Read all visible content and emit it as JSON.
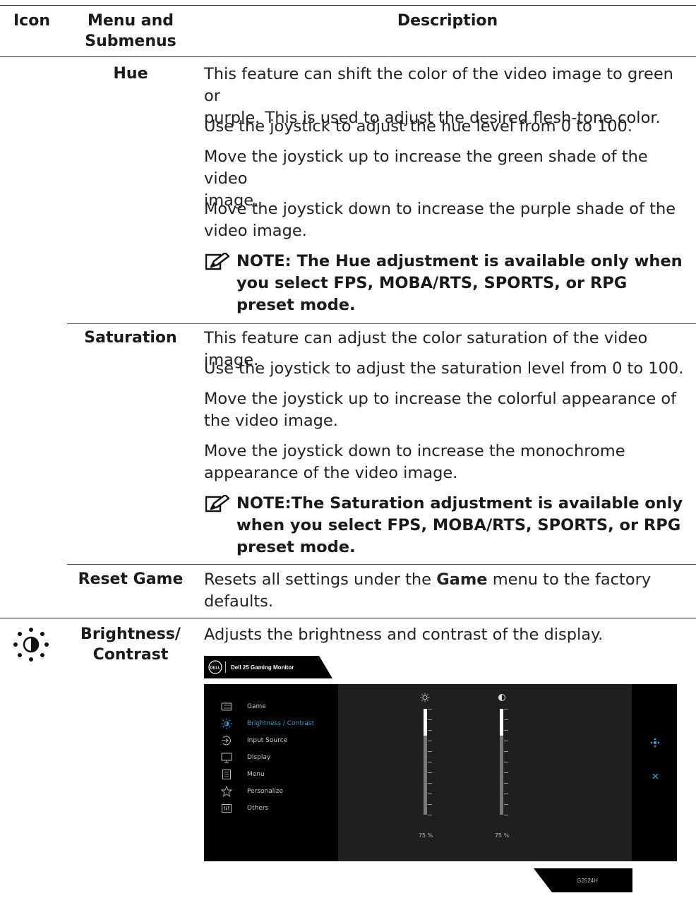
{
  "table_header": {
    "icon": "Icon",
    "menu_line1": "Menu and",
    "menu_line2": "Submenus",
    "description": "Description"
  },
  "rows": {
    "hue": {
      "name": "Hue",
      "p1a": "This feature can shift the color of the video image to green or",
      "p1b": "purple. This is used to adjust the desired flesh-tone color.",
      "p2": "Use the joystick to adjust the hue level from 0 to 100.",
      "p3a": "Move the joystick up to increase the green shade of the video",
      "p3b": "image.",
      "p4a": "Move the joystick down to increase the purple shade of the",
      "p4b": "video image.",
      "note_a": "NOTE: The Hue adjustment is available only when",
      "note_b": "you select FPS, MOBA/RTS, SPORTS, or RPG",
      "note_c": "preset mode."
    },
    "saturation": {
      "name": "Saturation",
      "p1": "This feature can adjust the color saturation of the video image.",
      "p2": "Use the joystick to adjust the saturation level from 0 to 100.",
      "p3a": "Move the joystick up to increase the colorful appearance of",
      "p3b": "the video image.",
      "p4a": "Move the joystick down to increase the monochrome",
      "p4b": "appearance of the video image.",
      "note_a": "NOTE:The Saturation adjustment is available only",
      "note_b": "when you select FPS, MOBA/RTS, SPORTS, or RPG",
      "note_c": "preset mode."
    },
    "reset_game": {
      "name": "Reset Game",
      "desc_pre": "Resets all settings under the ",
      "desc_bold": "Game",
      "desc_post": " menu to the factory",
      "desc_line2": "defaults."
    },
    "brightness": {
      "icon": "brightness-contrast-icon",
      "name_line1": "Brightness/",
      "name_line2": "Contrast",
      "desc": "Adjusts the brightness and contrast of the display."
    }
  },
  "osd": {
    "logo": "DELL",
    "title": "Dell 25 Gaming Monitor",
    "accent": "#2a9fd8",
    "menu": [
      {
        "label": "Game",
        "icon": "game-icon"
      },
      {
        "label": "Brightness / Contrast",
        "icon": "brightness-icon",
        "active": true
      },
      {
        "label": "Input Source",
        "icon": "input-source-icon"
      },
      {
        "label": "Display",
        "icon": "display-icon"
      },
      {
        "label": "Menu",
        "icon": "menu-icon"
      },
      {
        "label": "Personalize",
        "icon": "star-icon"
      },
      {
        "label": "Others",
        "icon": "others-icon"
      }
    ],
    "brightness_value": "75 %",
    "contrast_value": "75 %",
    "brightness_level": 0.25,
    "contrast_level": 0.25,
    "model": "G2524H"
  }
}
